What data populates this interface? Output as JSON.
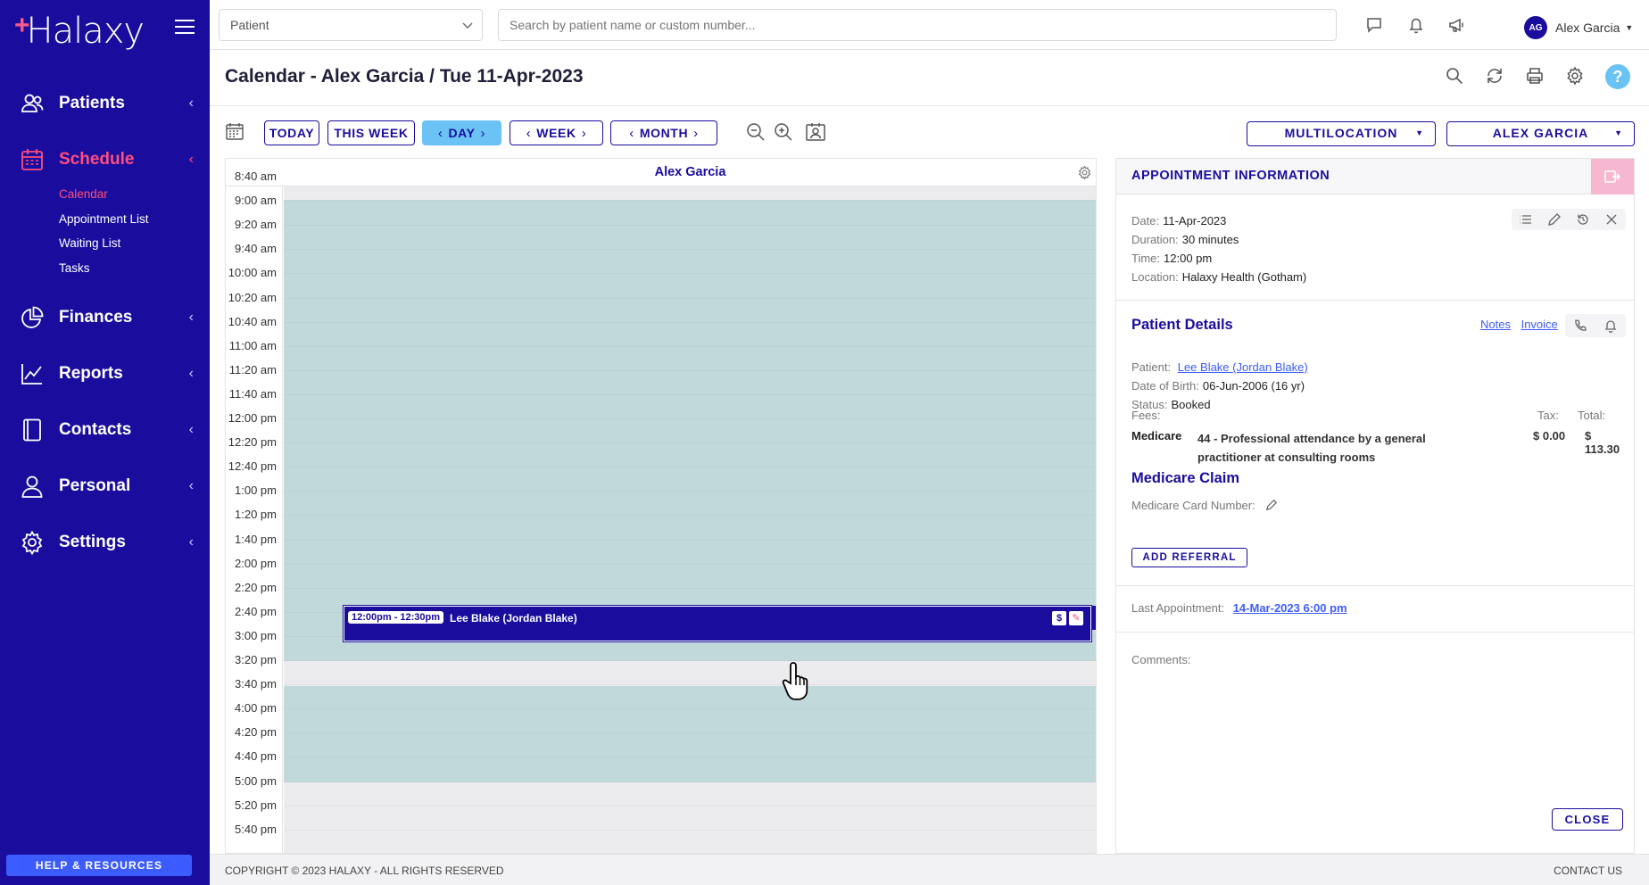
{
  "brand": {
    "name": "Halaxy"
  },
  "sidebar": {
    "items": [
      {
        "label": "Patients"
      },
      {
        "label": "Schedule"
      },
      {
        "label": "Finances"
      },
      {
        "label": "Reports"
      },
      {
        "label": "Contacts"
      },
      {
        "label": "Personal"
      },
      {
        "label": "Settings"
      }
    ],
    "schedule_sub": [
      "Calendar",
      "Appointment List",
      "Waiting List",
      "Tasks"
    ],
    "help_label": "HELP & RESOURCES"
  },
  "topbar": {
    "patient_select": "Patient",
    "search_placeholder": "Search by patient name or custom number...",
    "user_initials": "AG",
    "user_name": "Alex Garcia"
  },
  "page": {
    "title": "Calendar - Alex Garcia / Tue 11-Apr-2023"
  },
  "toolbar": {
    "today": "TODAY",
    "this_week": "THIS WEEK",
    "day": "DAY",
    "week": "WEEK",
    "month": "MONTH",
    "multilocation": "MULTILOCATION",
    "practitioner": "ALEX GARCIA"
  },
  "calendar": {
    "column_name": "Alex Garcia",
    "times": [
      "8:40 am",
      "9:00 am",
      "9:20 am",
      "9:40 am",
      "10:00 am",
      "10:20 am",
      "10:40 am",
      "11:00 am",
      "11:20 am",
      "11:40 am",
      "12:00 pm",
      "12:20 pm",
      "12:40 pm",
      "1:00 pm",
      "1:20 pm",
      "1:40 pm",
      "2:00 pm",
      "2:20 pm",
      "2:40 pm",
      "3:00 pm",
      "3:20 pm",
      "3:40 pm",
      "4:00 pm",
      "4:20 pm",
      "4:40 pm",
      "5:00 pm",
      "5:20 pm",
      "5:40 pm"
    ],
    "appointment": {
      "time": "12:00pm - 12:30pm",
      "patient": "Lee Blake (Jordan Blake)"
    }
  },
  "appointment_info": {
    "title": "APPOINTMENT INFORMATION",
    "date_label": "Date:",
    "date": "11-Apr-2023",
    "duration_label": "Duration:",
    "duration": "30 minutes",
    "time_label": "Time:",
    "time": "12:00 pm",
    "location_label": "Location:",
    "location": "Halaxy Health (Gotham)"
  },
  "patient_details": {
    "title": "Patient Details",
    "notes_link": "Notes",
    "invoice_link": "Invoice",
    "patient_label": "Patient:",
    "patient": "Lee Blake (Jordan Blake)",
    "dob_label": "Date of Birth:",
    "dob": "06-Jun-2006 (16 yr)",
    "status_label": "Status:",
    "status": "Booked",
    "fees_label": "Fees:",
    "tax_label": "Tax:",
    "total_label": "Total:",
    "fee": {
      "type": "Medicare",
      "description": "44 - Professional attendance by a general practitioner at consulting rooms",
      "tax": "$ 0.00",
      "total": "$ 113.30"
    }
  },
  "medicare_claim": {
    "title": "Medicare Claim",
    "card_label": "Medicare Card Number:",
    "add_referral": "ADD REFERRAL"
  },
  "last_appointment": {
    "label": "Last Appointment:",
    "value": "14-Mar-2023 6:00 pm"
  },
  "comments_label": "Comments:",
  "close_label": "CLOSE",
  "footer": {
    "copyright": "COPYRIGHT © 2023 HALAXY - ALL RIGHTS RESERVED",
    "contact": "CONTACT US"
  }
}
